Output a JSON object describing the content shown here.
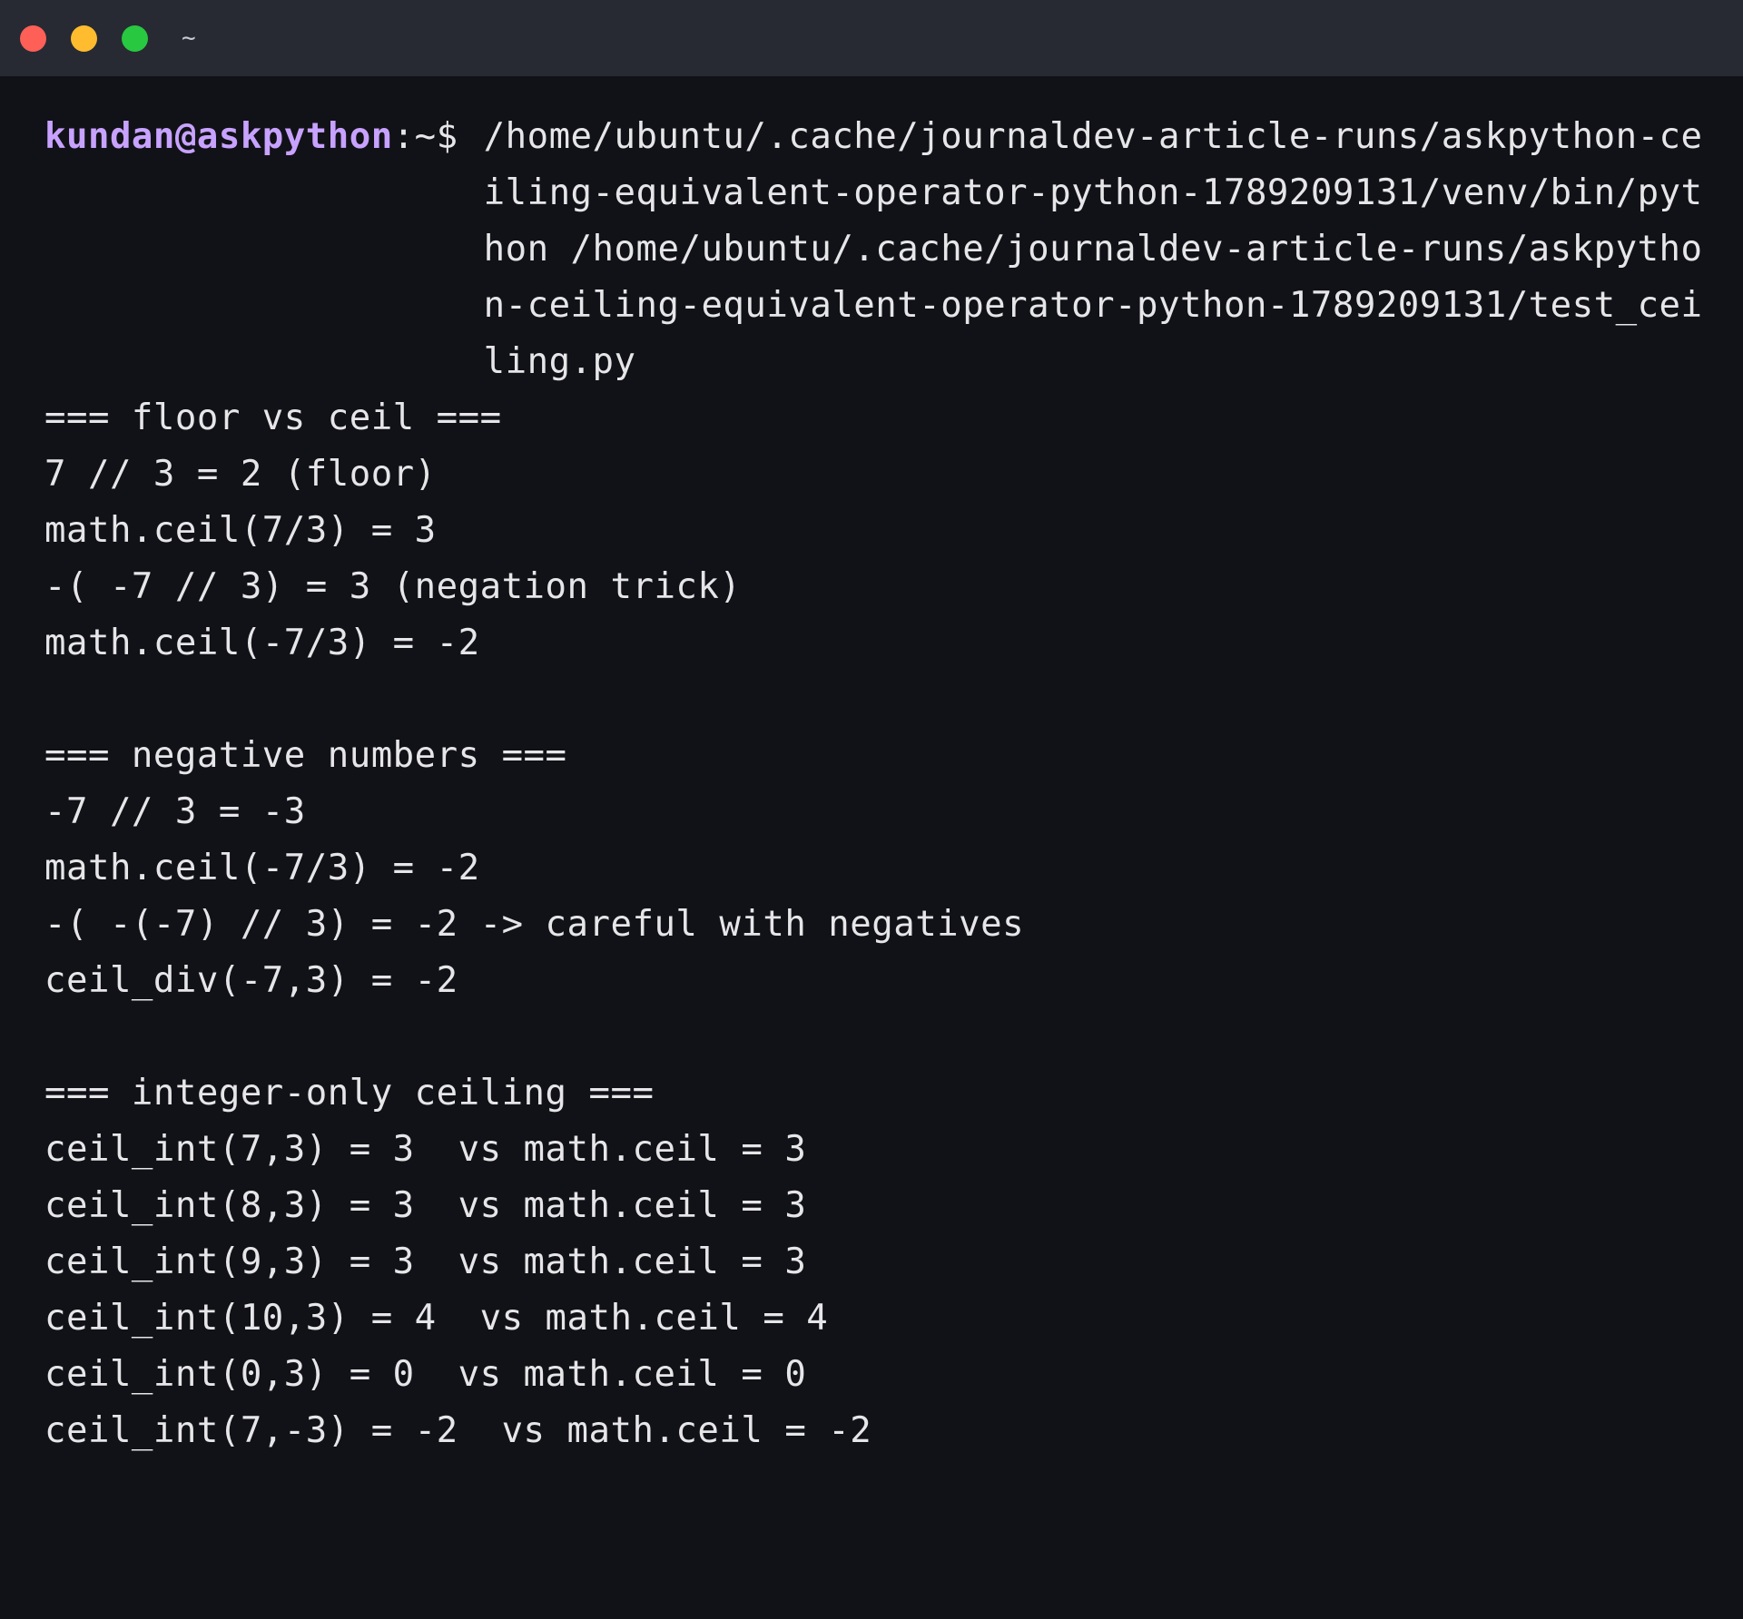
{
  "window": {
    "title": "~",
    "colors": {
      "close": "#fe5f57",
      "minimize": "#febc2e",
      "zoom": "#28c840",
      "titlebar_bg": "#272a33",
      "terminal_bg": "#111217",
      "prompt_user": "#c8a2ff",
      "text": "#e6e6e9"
    }
  },
  "prompt": {
    "user_host": "kundan@askpython",
    "path_symbol": ":~$",
    "command": "/home/ubuntu/.cache/journaldev-article-runs/askpython-ceiling-equivalent-operator-python-1789209131/venv/bin/python /home/ubuntu/.cache/journaldev-article-runs/askpython-ceiling-equivalent-operator-python-1789209131/test_ceiling.py"
  },
  "output": [
    "=== floor vs ceil ===",
    "7 // 3 = 2 (floor)",
    "math.ceil(7/3) = 3",
    "-( -7 // 3) = 3 (negation trick)",
    "math.ceil(-7/3) = -2",
    "",
    "=== negative numbers ===",
    "-7 // 3 = -3",
    "math.ceil(-7/3) = -2",
    "-( -(-7) // 3) = -2 -> careful with negatives",
    "ceil_div(-7,3) = -2",
    "",
    "=== integer-only ceiling ===",
    "ceil_int(7,3) = 3  vs math.ceil = 3",
    "ceil_int(8,3) = 3  vs math.ceil = 3",
    "ceil_int(9,3) = 3  vs math.ceil = 3",
    "ceil_int(10,3) = 4  vs math.ceil = 4",
    "ceil_int(0,3) = 0  vs math.ceil = 0",
    "ceil_int(7,-3) = -2  vs math.ceil = -2"
  ]
}
